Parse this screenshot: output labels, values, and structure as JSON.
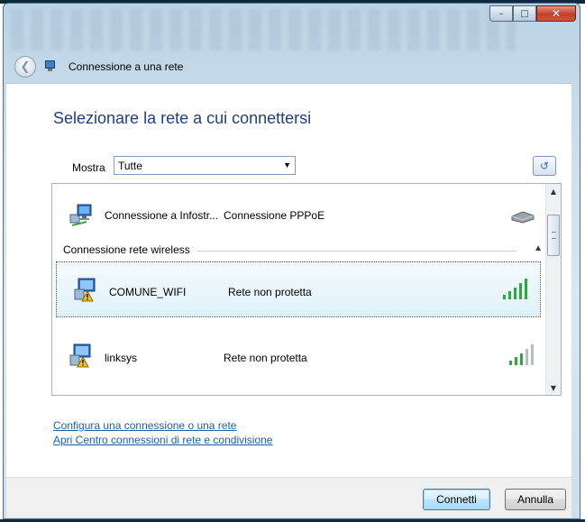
{
  "window": {
    "title": "Connessione a una rete",
    "caption_buttons": [
      "minimize",
      "maximize",
      "close"
    ]
  },
  "heading": "Selezionare la rete a cui connettersi",
  "filter": {
    "label": "Mostra",
    "selected": "Tutte"
  },
  "networks": [
    {
      "name": "Connessione a Infostr...",
      "type": "Connessione PPPoE",
      "icon": "network-computer-icon",
      "signal_icon": "modem-icon"
    },
    {
      "section": "Connessione rete wireless"
    },
    {
      "name": "COMUNE_WIFI",
      "type": "Rete non protetta",
      "icon": "unsecured-network-icon",
      "signal_bars": 5,
      "selected": true
    },
    {
      "name": "linksys",
      "type": "Rete non protetta",
      "icon": "unsecured-network-icon",
      "signal_bars": 3
    }
  ],
  "links": [
    "Configura una connessione o una rete",
    "Apri Centro connessioni di rete e condivisione"
  ],
  "buttons": {
    "connect": "Connetti",
    "cancel": "Annulla"
  },
  "colors": {
    "heading": "#1e3e8a",
    "link": "#1a5fb4",
    "signal": "#2fa83a"
  }
}
